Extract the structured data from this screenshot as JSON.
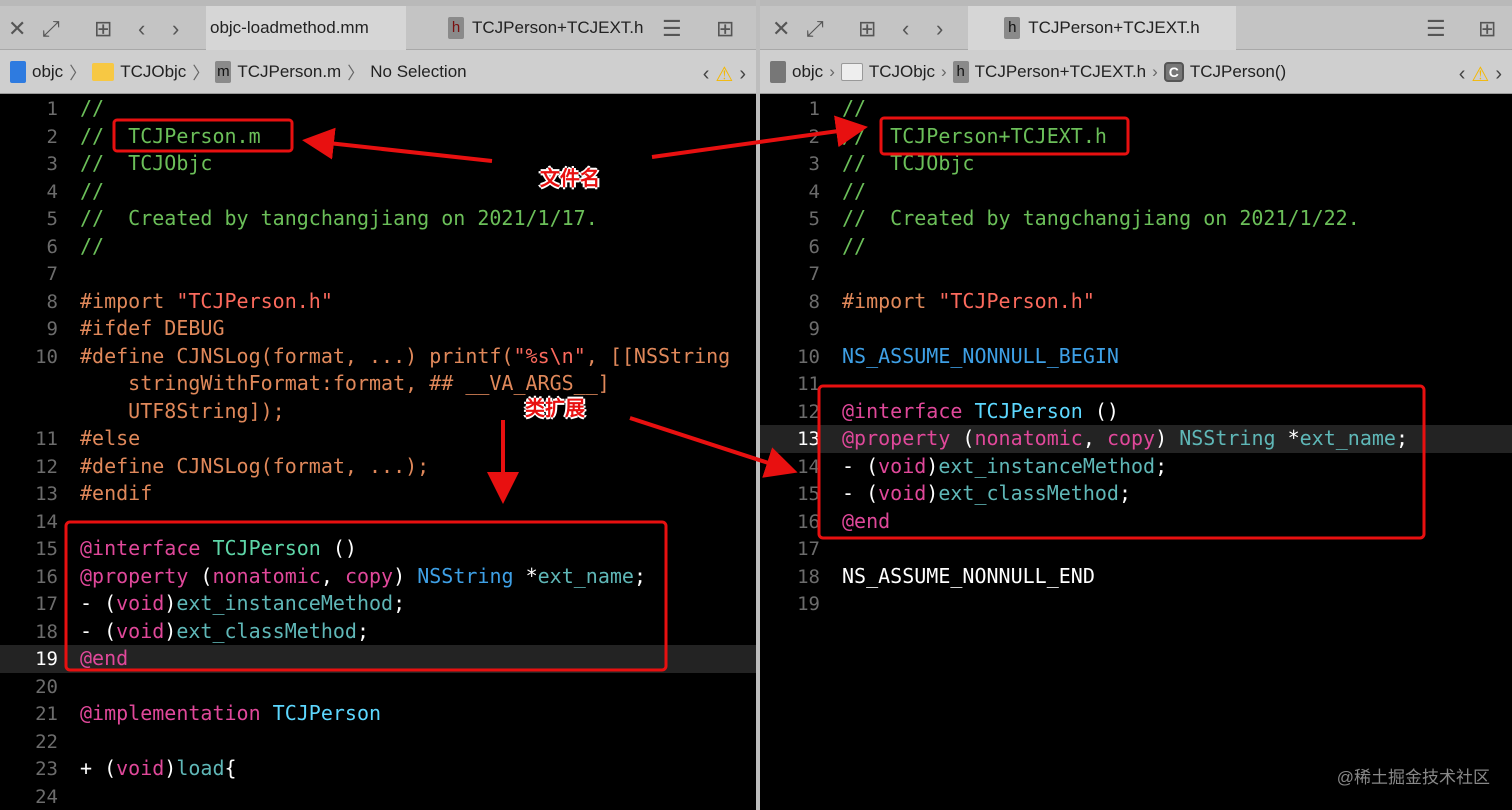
{
  "left": {
    "tabs": [
      {
        "label": "objc-loadmethod.mm",
        "badge": ""
      },
      {
        "label": "TCJPerson+TCJEXT.h",
        "badge": "h"
      }
    ],
    "breadcrumb": [
      {
        "label": "objc"
      },
      {
        "label": "TCJObjc"
      },
      {
        "label": "TCJPerson.m",
        "badge": "m"
      },
      {
        "label": "No Selection"
      }
    ],
    "highlight_line": "19",
    "rows": [
      {
        "n": "1",
        "t": [
          [
            "c",
            "//"
          ]
        ]
      },
      {
        "n": "2",
        "t": [
          [
            "c",
            "//  TCJPerson.m"
          ]
        ]
      },
      {
        "n": "3",
        "t": [
          [
            "c",
            "//  TCJObjc"
          ]
        ]
      },
      {
        "n": "4",
        "t": [
          [
            "c",
            "//"
          ]
        ]
      },
      {
        "n": "5",
        "t": [
          [
            "c",
            "//  Created by tangchangjiang on 2021/1/17."
          ]
        ]
      },
      {
        "n": "6",
        "t": [
          [
            "c",
            "//"
          ]
        ]
      },
      {
        "n": "7",
        "t": []
      },
      {
        "n": "8",
        "t": [
          [
            "p",
            "#import "
          ],
          [
            "s",
            "\"TCJPerson.h\""
          ]
        ]
      },
      {
        "n": "9",
        "t": [
          [
            "p",
            "#ifdef DEBUG"
          ]
        ]
      },
      {
        "n": "10",
        "t": [
          [
            "p",
            "#define CJNSLog(format, ...) printf("
          ],
          [
            "s",
            "\"%s\\n\""
          ],
          [
            "p",
            ", [[NSString"
          ]
        ]
      },
      {
        "n": "",
        "t": [
          [
            "p",
            "    stringWithFormat:format, ## __VA_ARGS__]"
          ]
        ]
      },
      {
        "n": "",
        "t": [
          [
            "p",
            "    UTF8String]);"
          ]
        ]
      },
      {
        "n": "11",
        "t": [
          [
            "p",
            "#else"
          ]
        ]
      },
      {
        "n": "12",
        "t": [
          [
            "p",
            "#define CJNSLog(format, ...);"
          ]
        ]
      },
      {
        "n": "13",
        "t": [
          [
            "p",
            "#endif"
          ]
        ]
      },
      {
        "n": "14",
        "t": []
      },
      {
        "n": "15",
        "t": [
          [
            "k",
            "@interface "
          ],
          [
            "g",
            "TCJPerson"
          ],
          [
            "o",
            " ()"
          ]
        ]
      },
      {
        "n": "16",
        "t": [
          [
            "k",
            "@property "
          ],
          [
            "o",
            "("
          ],
          [
            "k",
            "nonatomic"
          ],
          [
            "o",
            ", "
          ],
          [
            "k",
            "copy"
          ],
          [
            "o",
            ") "
          ],
          [
            "ns",
            "NSString "
          ],
          [
            "o",
            "*"
          ],
          [
            "m",
            "ext_name"
          ],
          [
            "o",
            ";"
          ]
        ]
      },
      {
        "n": "17",
        "t": [
          [
            "o",
            "- ("
          ],
          [
            "k",
            "void"
          ],
          [
            "o",
            ")"
          ],
          [
            "m",
            "ext_instanceMethod"
          ],
          [
            "o",
            ";"
          ]
        ]
      },
      {
        "n": "18",
        "t": [
          [
            "o",
            "- ("
          ],
          [
            "k",
            "void"
          ],
          [
            "o",
            ")"
          ],
          [
            "m",
            "ext_classMethod"
          ],
          [
            "o",
            ";"
          ]
        ]
      },
      {
        "n": "19",
        "t": [
          [
            "k",
            "@end"
          ]
        ]
      },
      {
        "n": "20",
        "t": []
      },
      {
        "n": "21",
        "t": [
          [
            "k",
            "@implementation "
          ],
          [
            "b",
            "TCJPerson"
          ]
        ]
      },
      {
        "n": "22",
        "t": []
      },
      {
        "n": "23",
        "t": [
          [
            "o",
            "+ ("
          ],
          [
            "k",
            "void"
          ],
          [
            "o",
            ")"
          ],
          [
            "m",
            "load"
          ],
          [
            "o",
            "{"
          ]
        ]
      },
      {
        "n": "24",
        "t": []
      }
    ]
  },
  "right": {
    "tabs": [
      {
        "label": "TCJPerson+TCJEXT.h",
        "badge": "h"
      }
    ],
    "breadcrumb": [
      {
        "label": "objc"
      },
      {
        "label": "TCJObjc"
      },
      {
        "label": "TCJPerson+TCJEXT.h",
        "badge": "h"
      },
      {
        "label": "TCJPerson()",
        "badge": "C"
      }
    ],
    "highlight_line": "13",
    "rows": [
      {
        "n": "1",
        "t": [
          [
            "c",
            "//"
          ]
        ]
      },
      {
        "n": "2",
        "t": [
          [
            "c",
            "//  TCJPerson+TCJEXT.h"
          ]
        ]
      },
      {
        "n": "3",
        "t": [
          [
            "c",
            "//  TCJObjc"
          ]
        ]
      },
      {
        "n": "4",
        "t": [
          [
            "c",
            "//"
          ]
        ]
      },
      {
        "n": "5",
        "t": [
          [
            "c",
            "//  Created by tangchangjiang on 2021/1/22."
          ]
        ]
      },
      {
        "n": "6",
        "t": [
          [
            "c",
            "//"
          ]
        ]
      },
      {
        "n": "7",
        "t": []
      },
      {
        "n": "8",
        "t": [
          [
            "p",
            "#import "
          ],
          [
            "s",
            "\"TCJPerson.h\""
          ]
        ]
      },
      {
        "n": "9",
        "t": []
      },
      {
        "n": "10",
        "t": [
          [
            "ns",
            "NS_ASSUME_NONNULL_BEGIN"
          ]
        ]
      },
      {
        "n": "11",
        "t": []
      },
      {
        "n": "12",
        "t": [
          [
            "k",
            "@interface "
          ],
          [
            "b",
            "TCJPerson"
          ],
          [
            "o",
            " ()"
          ]
        ]
      },
      {
        "n": "13",
        "t": [
          [
            "k",
            "@property "
          ],
          [
            "o",
            "("
          ],
          [
            "k",
            "nonatomic"
          ],
          [
            "o",
            ", "
          ],
          [
            "k",
            "copy"
          ],
          [
            "o",
            ") "
          ],
          [
            "m",
            "NSString "
          ],
          [
            "o",
            "*"
          ],
          [
            "m",
            "ext_name"
          ],
          [
            "o",
            ";"
          ]
        ]
      },
      {
        "n": "14",
        "t": [
          [
            "o",
            "- ("
          ],
          [
            "k",
            "void"
          ],
          [
            "o",
            ")"
          ],
          [
            "m",
            "ext_instanceMethod"
          ],
          [
            "o",
            ";"
          ]
        ]
      },
      {
        "n": "15",
        "t": [
          [
            "o",
            "- ("
          ],
          [
            "k",
            "void"
          ],
          [
            "o",
            ")"
          ],
          [
            "m",
            "ext_classMethod"
          ],
          [
            "o",
            ";"
          ]
        ]
      },
      {
        "n": "16",
        "t": [
          [
            "k",
            "@end"
          ]
        ]
      },
      {
        "n": "17",
        "t": []
      },
      {
        "n": "18",
        "t": [
          [
            "w",
            "NS_ASSUME_NONNULL_END"
          ]
        ]
      },
      {
        "n": "19",
        "t": []
      }
    ]
  },
  "annotations": {
    "filename_label": "文件名",
    "extension_label": "类扩展",
    "color": "#e81010"
  },
  "watermark": "@稀土掘金技术社区"
}
